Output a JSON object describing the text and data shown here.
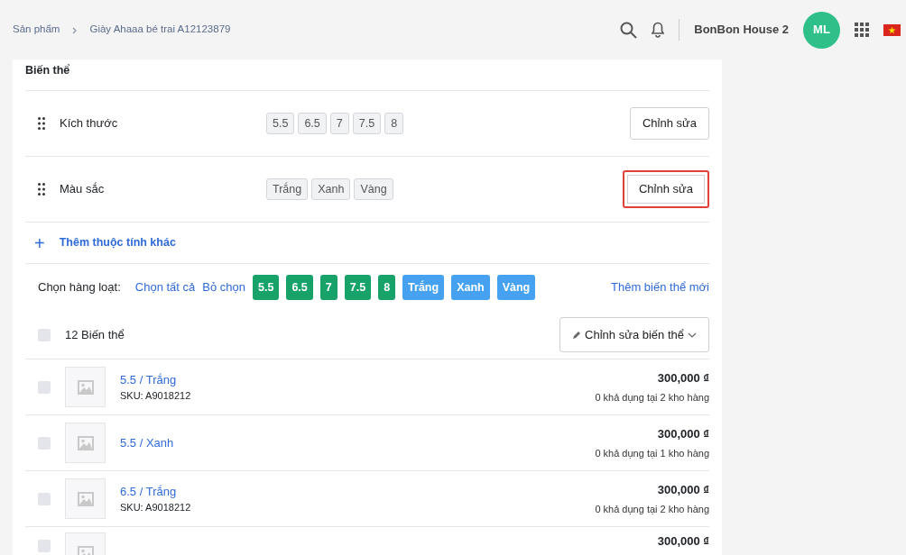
{
  "breadcrumb": [
    "Sản phẩm",
    "Giày Ahaaa bé trai A12123879"
  ],
  "header": {
    "store_name": "BonBon House 2",
    "avatar_initials": "ML"
  },
  "section_title": "Biến thể",
  "attributes": [
    {
      "name": "Kích thước",
      "values": [
        "5.5",
        "6.5",
        "7",
        "7.5",
        "8"
      ],
      "edit_label": "Chỉnh sửa",
      "highlighted": false
    },
    {
      "name": "Màu sắc",
      "values": [
        "Trắng",
        "Xanh",
        "Vàng"
      ],
      "edit_label": "Chỉnh sửa",
      "highlighted": true
    }
  ],
  "add_attribute": {
    "icon": "+",
    "label": "Thêm thuộc tính khác"
  },
  "bulk_select": {
    "label": "Chọn hàng loạt:",
    "select_all": "Chọn tất cả",
    "deselect": "Bỏ chọn",
    "chips": [
      {
        "label": "5.5",
        "kind": "size"
      },
      {
        "label": "6.5",
        "kind": "size"
      },
      {
        "label": "7",
        "kind": "size"
      },
      {
        "label": "7.5",
        "kind": "size"
      },
      {
        "label": "8",
        "kind": "size"
      },
      {
        "label": "Trắng",
        "kind": "color"
      },
      {
        "label": "Xanh",
        "kind": "color"
      },
      {
        "label": "Vàng",
        "kind": "color"
      }
    ],
    "add_variant": "Thêm biến thể mới"
  },
  "variant_summary": {
    "count_label": "12 Biến thể",
    "checked": false,
    "edit_button": "Chỉnh sửa biến thể"
  },
  "variants": [
    {
      "name": "5.5 / Trắng",
      "sku": "SKU: A9018212",
      "price": "300,000 ₫",
      "stock": "0 khả dụng tại 2 kho hàng",
      "checked": false
    },
    {
      "name": "5.5 / Xanh",
      "price": "300,000 ₫",
      "stock": "0 khả dụng tại 1 kho hàng",
      "checked": false
    },
    {
      "name": "6.5 / Trắng",
      "sku": "SKU: A9018212",
      "price": "300,000 ₫",
      "stock": "0 khả dụng tại 2 kho hàng",
      "checked": false
    },
    {
      "price": "300,000 ₫",
      "checked": false
    }
  ]
}
